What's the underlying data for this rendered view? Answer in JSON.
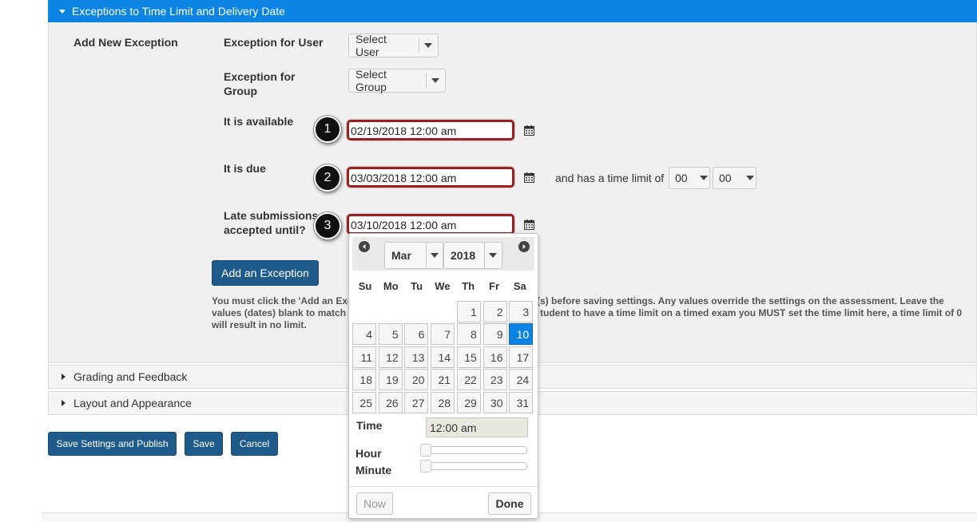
{
  "section": {
    "title": "Exceptions to Time Limit and Delivery Date",
    "heading": "Add New Exception"
  },
  "fields": {
    "user_label": "Exception for User",
    "user_select": "Select User",
    "group_label": "Exception for Group",
    "group_select": "Select Group",
    "available_label": "It is available",
    "available_value": "02/19/2018 12:00 am",
    "due_label": "It is due",
    "due_value": "03/03/2018 12:00 am",
    "late_label": "Late submissions accepted until?",
    "late_value": "03/10/2018 12:00 am",
    "time_limit_text": "and has a time limit of",
    "hours": "00",
    "minutes": "00"
  },
  "badges": [
    "1",
    "2",
    "3"
  ],
  "add_exception_button": "Add an Exception",
  "help_text_1": "You must click the 'Add an Exc",
  "help_text_1b": "(s) before saving settings. Any values override the settings on the assessment. Leave the",
  "help_text_2": "values (dates) blank to match t",
  "help_text_2b": "tudent to have a time limit on a timed exam you MUST set the time limit here, a time limit of 0",
  "help_text_3": "will result in no limit.",
  "collapsed_sections": [
    "Grading and Feedback",
    "Layout and Appearance"
  ],
  "buttons": {
    "save_publish": "Save Settings and Publish",
    "save": "Save",
    "cancel": "Cancel"
  },
  "datepicker": {
    "month": "Mar",
    "year": "2018",
    "weekdays": [
      "Su",
      "Mo",
      "Tu",
      "We",
      "Th",
      "Fr",
      "Sa"
    ],
    "weeks": [
      [
        "",
        "",
        "",
        "",
        "1",
        "2",
        "3"
      ],
      [
        "4",
        "5",
        "6",
        "7",
        "8",
        "9",
        "10"
      ],
      [
        "11",
        "12",
        "13",
        "14",
        "15",
        "16",
        "17"
      ],
      [
        "18",
        "19",
        "20",
        "21",
        "22",
        "23",
        "24"
      ],
      [
        "25",
        "26",
        "27",
        "28",
        "29",
        "30",
        "31"
      ]
    ],
    "selected_day": "10",
    "time_label": "Time",
    "time_value": "12:00 am",
    "hour_label": "Hour",
    "minute_label": "Minute",
    "hour_level": 0,
    "minute_level": 0,
    "now_button": "Now",
    "done_button": "Done"
  },
  "colors": {
    "accent": "#0c84e4",
    "highlight_border": "#9b1f1f",
    "button_dark": "#1f5b8a"
  },
  "icons": [
    "caret-down-icon",
    "calendar-icon",
    "dropdown-arrow-icon",
    "prev-month-icon",
    "next-month-icon",
    "caret-right-icon"
  ]
}
